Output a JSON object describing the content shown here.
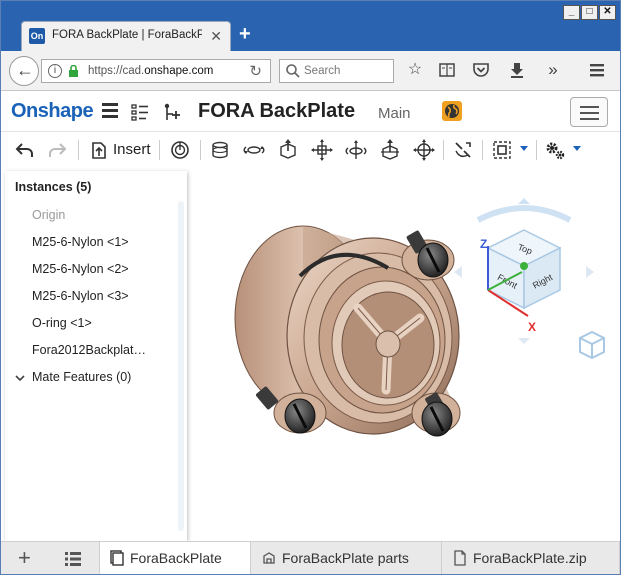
{
  "browser": {
    "tab_title": "FORA BackPlate | ForaBackPl…",
    "favicon_text": "On",
    "url_prefix": "https://cad.",
    "url_domain": "onshape.com",
    "search_placeholder": "Search"
  },
  "app": {
    "logo": "Onshape",
    "document_title": "FORA BackPlate",
    "workspace": "Main",
    "accent_color": "#1a62b8"
  },
  "toolbar": {
    "insert_label": "Insert"
  },
  "instances": {
    "title": "Instances (5)",
    "items": [
      {
        "label": "Origin",
        "dim": true
      },
      {
        "label": "M25-6-Nylon <1>"
      },
      {
        "label": "M25-6-Nylon <2>"
      },
      {
        "label": "M25-6-Nylon <3>"
      },
      {
        "label": "O-ring <1>"
      },
      {
        "label": "Fora2012Backplat…"
      }
    ],
    "mate_features": "Mate Features (0)"
  },
  "viewcube": {
    "face_top": "Top",
    "face_front": "Front",
    "face_right": "Right",
    "axis_z": "Z",
    "axis_x": "X"
  },
  "bottom_tabs": [
    {
      "label": "ForaBackPlate",
      "active": true
    },
    {
      "label": "ForaBackPlate parts"
    },
    {
      "label": "ForaBackPlate.zip"
    }
  ]
}
